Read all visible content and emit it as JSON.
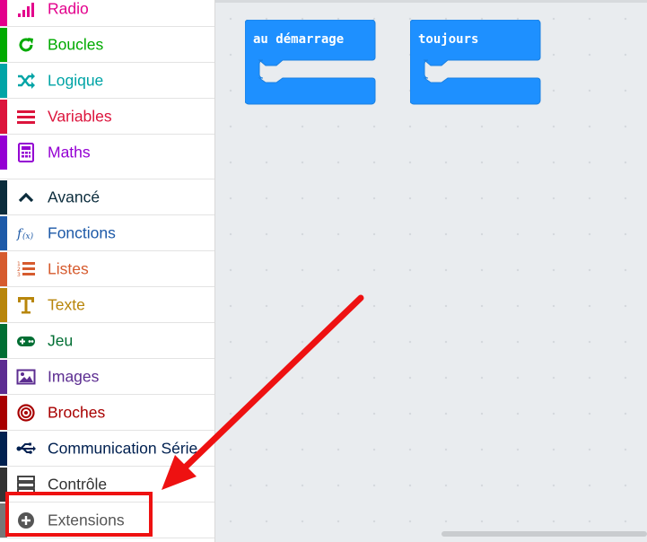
{
  "toolbox": {
    "categories": [
      {
        "label": "Radio",
        "color": "#e3008c",
        "icon": "signal-bars-icon"
      },
      {
        "label": "Boucles",
        "color": "#00aa00",
        "icon": "loop-arrow-icon"
      },
      {
        "label": "Logique",
        "color": "#00a4a6",
        "icon": "shuffle-icon"
      },
      {
        "label": "Variables",
        "color": "#dc143c",
        "icon": "list-lines-icon"
      },
      {
        "label": "Maths",
        "color": "#9400d3",
        "icon": "calculator-icon"
      }
    ],
    "advanced": [
      {
        "label": "Avancé",
        "color": "#0b2c3c",
        "text_color": "#0b2c3c",
        "icon": "chevron-up-icon"
      },
      {
        "label": "Fonctions",
        "color": "#1e5aa8",
        "icon": "function-icon"
      },
      {
        "label": "Listes",
        "color": "#d65b2e",
        "icon": "numbered-list-icon"
      },
      {
        "label": "Texte",
        "color": "#b8860b",
        "icon": "text-t-icon"
      },
      {
        "label": "Jeu",
        "color": "#006e33",
        "icon": "gamepad-icon"
      },
      {
        "label": "Images",
        "color": "#5c2d91",
        "icon": "image-icon"
      },
      {
        "label": "Broches",
        "color": "#a80000",
        "icon": "target-icon"
      },
      {
        "label": "Communication Série",
        "color": "#002050",
        "icon": "usb-icon"
      },
      {
        "label": "Contrôle",
        "color": "#333333",
        "icon": "server-icon"
      },
      {
        "label": "Extensions",
        "color": "#777777",
        "icon": "plus-circle-icon"
      }
    ]
  },
  "workspace": {
    "blocks": [
      {
        "label": "au démarrage",
        "color": "#1e90ff"
      },
      {
        "label": "toujours",
        "color": "#1e90ff"
      }
    ]
  },
  "annotation": {
    "color": "#ee1111"
  }
}
